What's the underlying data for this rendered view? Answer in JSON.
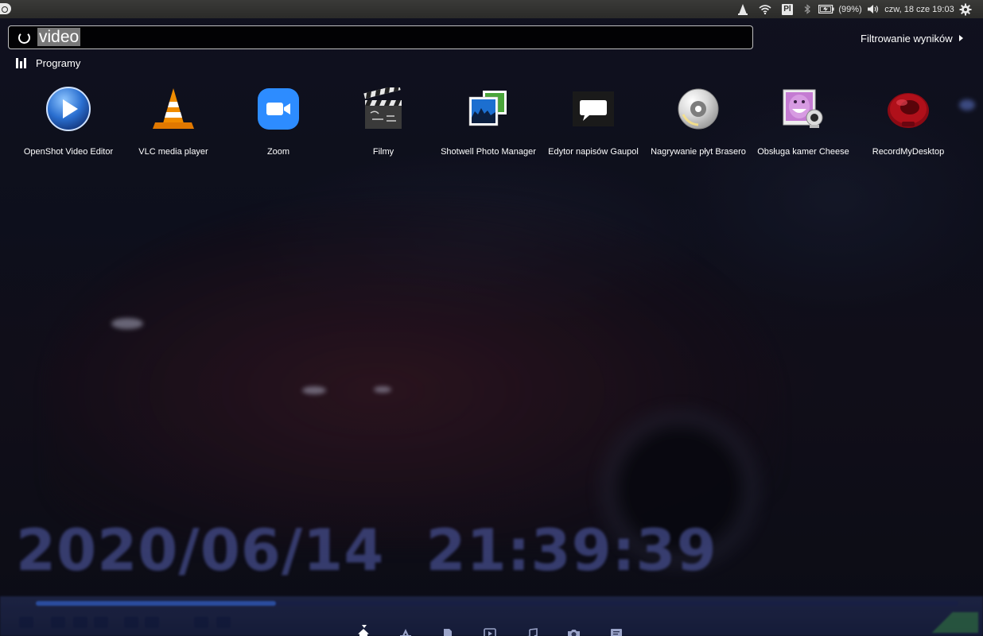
{
  "background": {
    "timestamp": "2020/06/14  21:39:39",
    "playback_progress": 0.26
  },
  "top_panel": {
    "keyboard_layout": "Pl",
    "battery": "(99%)",
    "clock": "czw, 18 cze 19:03",
    "icons": [
      "ubuntu-dash-icon",
      "vlc-tray-icon",
      "wifi-icon",
      "keyboard-layout-indicator",
      "bluetooth-icon",
      "battery-icon",
      "volume-icon",
      "settings-gear-icon"
    ]
  },
  "search": {
    "query": "video"
  },
  "filter": {
    "label": "Filtrowanie wyników"
  },
  "category": {
    "label": "Programy"
  },
  "apps": [
    {
      "label": "OpenShot Video Editor",
      "icon": "openshot-icon"
    },
    {
      "label": "VLC media player",
      "icon": "vlc-icon"
    },
    {
      "label": "Zoom",
      "icon": "zoom-icon"
    },
    {
      "label": "Filmy",
      "icon": "clapperboard-icon"
    },
    {
      "label": "Shotwell Photo Manager",
      "icon": "shotwell-icon"
    },
    {
      "label": "Edytor napisów Gaupol",
      "icon": "speech-bubble-icon"
    },
    {
      "label": "Nagrywanie płyt Brasero",
      "icon": "cd-disc-icon"
    },
    {
      "label": "Obsługa kamer Cheese",
      "icon": "cheese-webcam-icon"
    },
    {
      "label": "RecordMyDesktop",
      "icon": "record-icon"
    }
  ],
  "lenses": [
    "home-lens-icon",
    "applications-lens-icon",
    "files-lens-icon",
    "video-lens-icon",
    "music-lens-icon",
    "photo-lens-icon",
    "social-lens-icon"
  ],
  "colors": {
    "accent": "#3d8be0",
    "vlc_orange": "#f08c00",
    "zoom_blue": "#2d8cff",
    "record_red": "#b0101a"
  }
}
